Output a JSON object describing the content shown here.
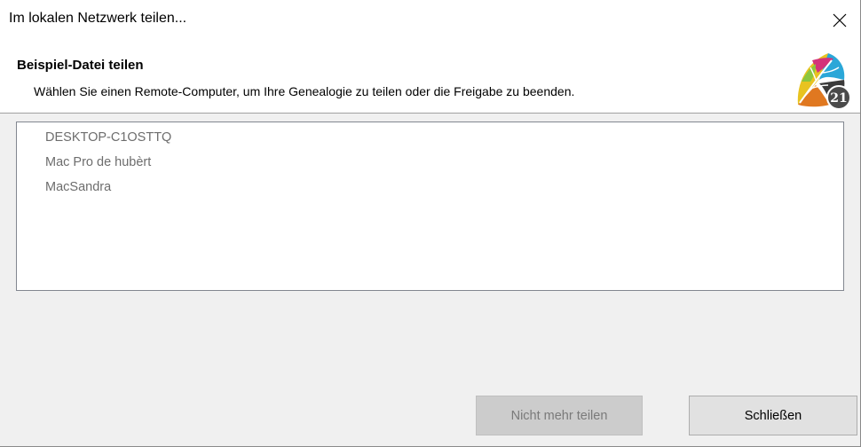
{
  "window": {
    "title": "Im lokalen Netzwerk teilen..."
  },
  "header": {
    "title": "Beispiel-Datei teilen",
    "subtitle": "Wählen Sie einen Remote-Computer, um Ihre Genealogie zu teilen oder die Freigabe zu beenden.",
    "logo_icon": "family-tree-leaf-21-logo"
  },
  "computers": {
    "items": [
      {
        "label": "DESKTOP-C1OSTTQ"
      },
      {
        "label": "Mac Pro de hubèrt"
      },
      {
        "label": "MacSandra"
      }
    ]
  },
  "buttons": {
    "stop_sharing_label": "Nicht mehr teilen",
    "stop_sharing_enabled": false,
    "close_label": "Schließen"
  },
  "icons": {
    "close": "close-icon"
  },
  "colors": {
    "disabled_button": "#cccccc",
    "button": "#e1e1e1",
    "list_text": "#6d6d6d"
  }
}
